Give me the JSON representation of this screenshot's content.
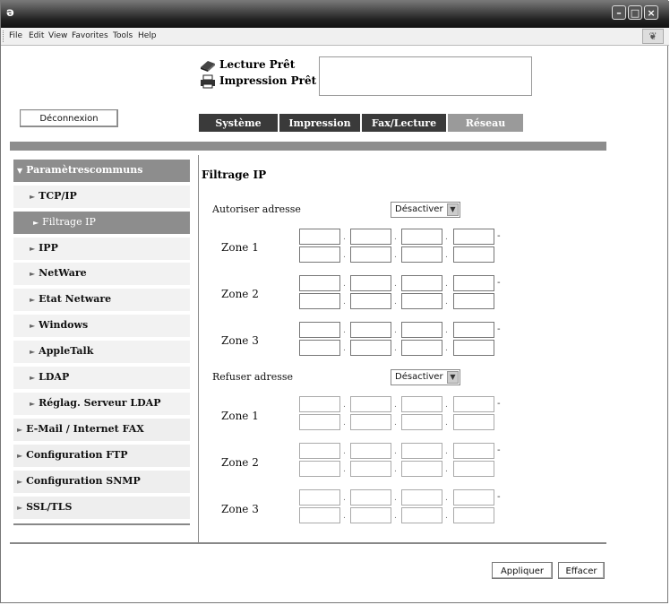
{
  "window": {
    "app_icon": "ie-icon",
    "controls": [
      "minimize-icon",
      "maximize-icon",
      "close-icon"
    ]
  },
  "menu": {
    "items": [
      "File",
      "Edit",
      "View",
      "Favorites",
      "Tools",
      "Help"
    ]
  },
  "status": {
    "scan": "Lecture Prêt",
    "print": "Impression Prêt"
  },
  "logout_label": "Déconnexion",
  "tabs": [
    "Système",
    "Impression",
    "Fax/Lecture",
    "Réseau"
  ],
  "sidebar": {
    "items": [
      {
        "label": "Paramètrescommuns"
      },
      {
        "label": "TCP/IP"
      },
      {
        "label": "Filtrage IP"
      },
      {
        "label": "IPP"
      },
      {
        "label": "NetWare"
      },
      {
        "label": "Etat Netware"
      },
      {
        "label": "Windows"
      },
      {
        "label": "AppleTalk"
      },
      {
        "label": "LDAP"
      },
      {
        "label": "Réglag. Serveur LDAP"
      },
      {
        "label": "E-Mail / Internet FAX"
      },
      {
        "label": "Configuration FTP"
      },
      {
        "label": "Configuration SNMP"
      },
      {
        "label": "SSL/TLS"
      }
    ]
  },
  "main": {
    "title": "Filtrage IP",
    "allow": {
      "label": "Autoriser adresse",
      "value": "Désactiver",
      "zones": [
        "Zone 1",
        "Zone 2",
        "Zone 3"
      ]
    },
    "deny": {
      "label": "Refuser adresse",
      "value": "Désactiver",
      "zones": [
        "Zone 1",
        "Zone 2",
        "Zone 3"
      ]
    }
  },
  "buttons": {
    "apply": "Appliquer",
    "clear": "Effacer"
  },
  "colors": {
    "tab_dark": "#3a3a3a",
    "tab_light": "#9a9a9a",
    "band": "#8d8d8d"
  }
}
